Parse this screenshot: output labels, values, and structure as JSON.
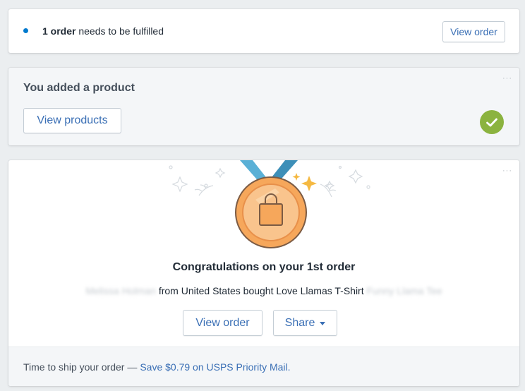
{
  "order_notice": {
    "count": "1 order",
    "text": "needs to be fulfilled",
    "button_label": "View order"
  },
  "product_card": {
    "title": "You added a product",
    "button_label": "View products",
    "status": "complete",
    "more_label": "···"
  },
  "congrats_card": {
    "title": "Congratulations on your 1st order",
    "customer_name": "Melissa Holman",
    "middle_text": "from United States bought Love Llamas T-Shirt",
    "product_variant": "Funny Llama Tee",
    "view_order_label": "View order",
    "share_label": "Share",
    "more_label": "···",
    "footer_text": "Time to ship your order —",
    "footer_link": "Save $0.79 on USPS Priority Mail."
  },
  "colors": {
    "accent": "#3a6fb5",
    "success": "#8bb33f",
    "medal": "#f6a75b",
    "ribbon": "#5ab0d6",
    "dot": "#007ace"
  }
}
